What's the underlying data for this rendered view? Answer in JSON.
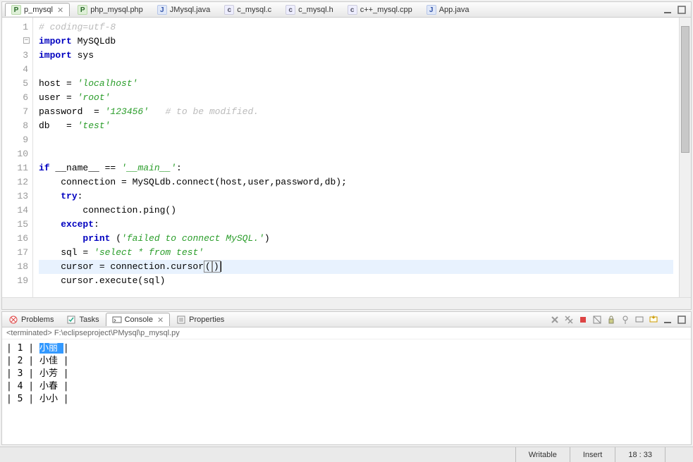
{
  "editor_tabs": [
    {
      "label": "p_mysql",
      "icon": "P",
      "icon_class": "fi-p",
      "active": true,
      "closable": true
    },
    {
      "label": "php_mysql.php",
      "icon": "P",
      "icon_class": "fi-p",
      "active": false,
      "closable": false
    },
    {
      "label": "JMysql.java",
      "icon": "J",
      "icon_class": "fi-j",
      "active": false,
      "closable": false
    },
    {
      "label": "c_mysql.c",
      "icon": "c",
      "icon_class": "fi-c",
      "active": false,
      "closable": false
    },
    {
      "label": "c_mysql.h",
      "icon": "c",
      "icon_class": "fi-c",
      "active": false,
      "closable": false
    },
    {
      "label": "c++_mysql.cpp",
      "icon": "c",
      "icon_class": "fi-c",
      "active": false,
      "closable": false
    },
    {
      "label": "App.java",
      "icon": "J",
      "icon_class": "fi-j",
      "active": false,
      "closable": false
    }
  ],
  "code_lines": [
    {
      "n": 1,
      "html": "<span class='tok-com'># coding=utf-8</span>"
    },
    {
      "n": 2,
      "fold": true,
      "html": "<span class='tok-kw2'>import</span> MySQLdb"
    },
    {
      "n": 3,
      "html": "<span class='tok-kw2'>import</span> sys"
    },
    {
      "n": 4,
      "html": ""
    },
    {
      "n": 5,
      "html": "host = <span class='tok-str'>'localhost'</span>"
    },
    {
      "n": 6,
      "html": "user = <span class='tok-str'>'root'</span>"
    },
    {
      "n": 7,
      "html": "password  = <span class='tok-str'>'123456'</span>   <span class='tok-com'># to be modified.</span>"
    },
    {
      "n": 8,
      "html": "db   = <span class='tok-str'>'test'</span>"
    },
    {
      "n": 9,
      "html": ""
    },
    {
      "n": 10,
      "html": ""
    },
    {
      "n": 11,
      "html": "<span class='tok-kw2'>if</span> __name__ == <span class='tok-str'>'__main__'</span>:"
    },
    {
      "n": 12,
      "html": "    connection = MySQLdb.connect(host,user,password,db);"
    },
    {
      "n": 13,
      "html": "    <span class='tok-kw2'>try</span>:"
    },
    {
      "n": 14,
      "html": "        connection.ping()"
    },
    {
      "n": 15,
      "html": "    <span class='tok-kw2'>except</span>:"
    },
    {
      "n": 16,
      "html": "        <span class='tok-kw2'>print</span> (<span class='tok-str'>'failed to connect MySQL.'</span>)"
    },
    {
      "n": 17,
      "html": "    sql = <span class='tok-str'>'select * from test'</span>"
    },
    {
      "n": 18,
      "hl": true,
      "html": "    cursor = connection.cursor<span class='bracket-box'>(</span><span class='bracket-box'>)</span><span class='tok-caret'></span>"
    },
    {
      "n": 19,
      "html": "    cursor.execute(sql)"
    }
  ],
  "view_tabs": [
    {
      "label": "Problems",
      "active": false
    },
    {
      "label": "Tasks",
      "active": false
    },
    {
      "label": "Console",
      "active": true,
      "closable": true
    },
    {
      "label": "Properties",
      "active": false
    }
  ],
  "console": {
    "header": "<terminated> F:\\eclipseproject\\PMysql\\p_mysql.py",
    "rows": [
      {
        "id": "1",
        "name": "小丽",
        "selected": true
      },
      {
        "id": "2",
        "name": "小佳"
      },
      {
        "id": "3",
        "name": "小芳"
      },
      {
        "id": "4",
        "name": "小春"
      },
      {
        "id": "5",
        "name": "小小"
      }
    ]
  },
  "status": {
    "writable": "Writable",
    "insert": "Insert",
    "pos": "18 : 33"
  }
}
